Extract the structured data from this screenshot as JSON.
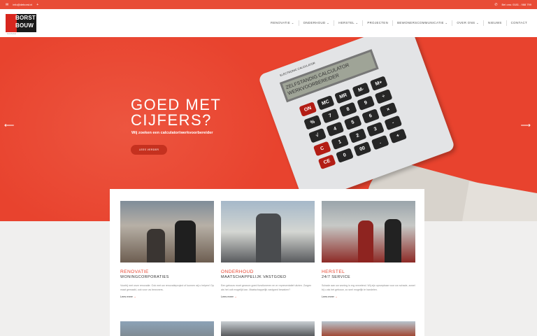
{
  "topbar": {
    "email": "info@deborst.nl",
    "social_icon": "plus-icon",
    "phone": "Bel ons: 0181 - 988 799"
  },
  "brand": {
    "logo_line1": "BORST",
    "logo_line2": "BOUW",
    "logo_tagline": "bouwbedrijf"
  },
  "nav": {
    "items": [
      {
        "label": "RENOVATIE",
        "dropdown": true
      },
      {
        "label": "ONDERHOUD",
        "dropdown": true
      },
      {
        "label": "HERSTEL",
        "dropdown": true
      },
      {
        "label": "PROJECTEN",
        "dropdown": false
      },
      {
        "label": "BEWONERSCOMMUNICATIE",
        "dropdown": true
      },
      {
        "label": "OVER ONS",
        "dropdown": true
      },
      {
        "label": "NIEUWS",
        "dropdown": false
      },
      {
        "label": "CONTACT",
        "dropdown": false
      }
    ]
  },
  "hero": {
    "headline_line1": "GOED MET",
    "headline_line2": "CIJFERS?",
    "subline": "Wij zoeken een calculator/werkvoorbereider",
    "cta_label": "LEES VERDER",
    "calc_brand": "ELECTRONIC CALCULATOR",
    "calc_screen_line1": "ZELFSTANDIG CALCULATOR",
    "calc_screen_line2": "WERKVOORBEREIDER",
    "background_color": "#e8432e"
  },
  "services": [
    {
      "title": "RENOVATIE",
      "subtitle": "WONINGCORPORATIES",
      "text": "Voorbij met onze renovatie. Ook met uw renovatieproject of kunnen wij u helpen! Op maat gemaakt, ook voor uw bewoners.",
      "more": "Lees meer",
      "image": "renovatie-photo"
    },
    {
      "title": "ONDERHOUD",
      "subtitle": "MAATSCHAPPELIJK VASTGOED",
      "text": "Een gebouw moet gewoon goed functioneren en er representatief uitzien. Zorgen als het ooit mogelijk kan. Maatschappelijk vastgoed bewaken?",
      "more": "Lees meer",
      "image": "onderhoud-photo"
    },
    {
      "title": "HERSTEL",
      "subtitle": "24/7 SERVICE",
      "text": "Schade aan uw woning is erg vervelend. Wij zijn oproepbaar voor uw schade, zowel bij u als het gebouw, zo snel mogelijk te handelen.",
      "more": "Lees meer",
      "image": "herstel-photo"
    }
  ],
  "calculator_keys": [
    "ON",
    "MC",
    "MR",
    "M-",
    "M+",
    "%",
    "7",
    "8",
    "9",
    "÷",
    "√",
    "4",
    "5",
    "6",
    "×",
    "C",
    "1",
    "2",
    "3",
    "-",
    "CE",
    "0",
    "00",
    ".",
    "+"
  ]
}
